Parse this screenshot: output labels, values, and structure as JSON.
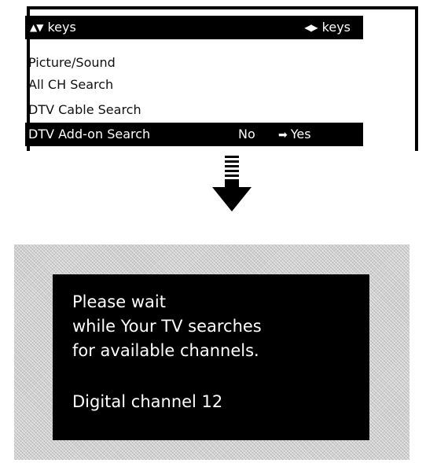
{
  "menu": {
    "header": {
      "left_arrows": "▲▼",
      "left_label": "keys",
      "right_arrows": "◀▶",
      "right_label": "keys"
    },
    "items": [
      {
        "label": "Picture/Sound"
      },
      {
        "label": "All CH Search"
      },
      {
        "label": "DTV Cable Search"
      }
    ],
    "selected_item": {
      "label": "DTV Add-on Search",
      "option_no": "No",
      "option_yes_pointer": "➡",
      "option_yes": "Yes"
    }
  },
  "transition_icon": "down-arrow-icon",
  "wait_screen": {
    "lines": [
      "Please wait",
      "while Your TV searches",
      "for available channels."
    ],
    "status": "Digital channel 12"
  }
}
